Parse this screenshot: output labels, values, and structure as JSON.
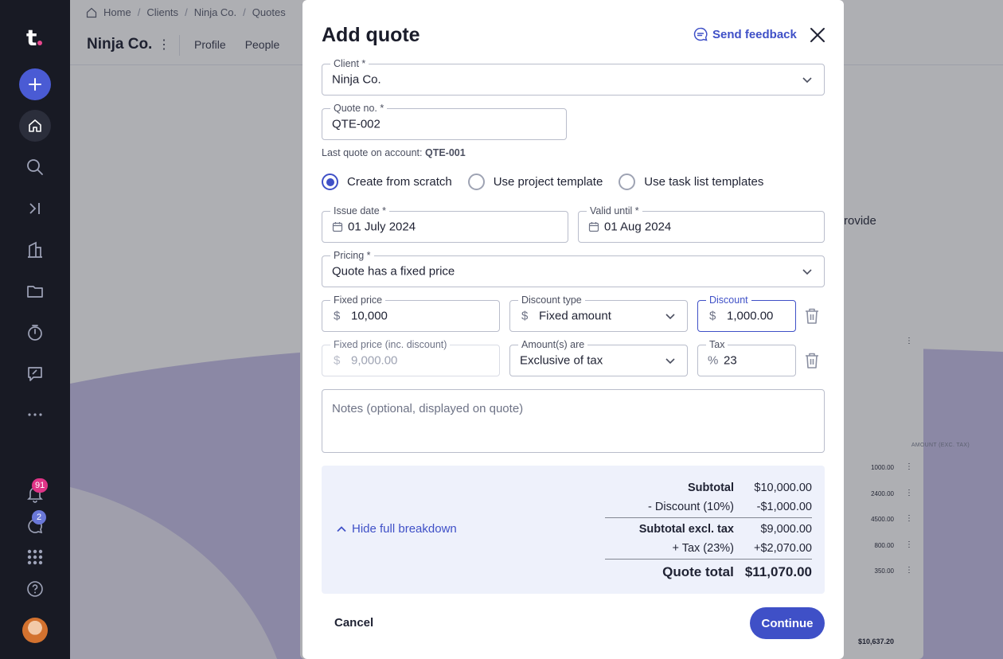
{
  "sidebar": {
    "logo": "t",
    "notifications_count": "91",
    "messages_count": "2"
  },
  "background": {
    "breadcrumb": [
      "Home",
      "Clients",
      "Ninja Co.",
      "Quotes"
    ],
    "title": "Ninja Co.",
    "tabs": [
      "Profile",
      "People"
    ],
    "partial_text": "rovide",
    "table_header": "AMOUNT (EXC. TAX)",
    "table_values": [
      "1000.00",
      "2400.00",
      "4500.00",
      "800.00",
      "350.00"
    ],
    "table_total": "$10,637.20"
  },
  "modal": {
    "title": "Add quote",
    "feedback_label": "Send feedback",
    "client": {
      "label": "Client *",
      "value": "Ninja Co."
    },
    "quote_no": {
      "label": "Quote no. *",
      "value": "QTE-002"
    },
    "last_quote_hint": "Last quote on account: ",
    "last_quote_value": "QTE-001",
    "radio_options": [
      "Create from scratch",
      "Use project template",
      "Use task list templates"
    ],
    "selected_radio": "Create from scratch",
    "issue_date": {
      "label": "Issue date *",
      "value": "01 July 2024"
    },
    "valid_until": {
      "label": "Valid until *",
      "value": "01 Aug 2024"
    },
    "pricing": {
      "label": "Pricing *",
      "value": "Quote has a fixed price"
    },
    "fixed_price": {
      "label": "Fixed price",
      "prefix": "$",
      "value": "10,000"
    },
    "discount_type": {
      "label": "Discount type",
      "prefix": "$",
      "value": "Fixed amount"
    },
    "discount": {
      "label": "Discount",
      "prefix": "$",
      "value": "1,000.00"
    },
    "fixed_price_inc": {
      "label": "Fixed price (inc. discount)",
      "prefix": "$",
      "value": "9,000.00"
    },
    "amounts_are": {
      "label": "Amount(s) are",
      "value": "Exclusive of tax"
    },
    "tax": {
      "label": "Tax",
      "prefix": "%",
      "value": "23"
    },
    "notes_placeholder": "Notes (optional, displayed on quote)",
    "breakdown_label": "Hide full breakdown",
    "summary": {
      "subtotal_label": "Subtotal",
      "subtotal_value": "$10,000.00",
      "discount_label": "- Discount (10%)",
      "discount_value": "-$1,000.00",
      "subtotal_excl_label": "Subtotal excl. tax",
      "subtotal_excl_value": "$9,000.00",
      "tax_label": "+ Tax (23%)",
      "tax_value": "+$2,070.00",
      "total_label": "Quote total",
      "total_value": "$11,070.00"
    },
    "cancel_label": "Cancel",
    "continue_label": "Continue"
  },
  "colors": {
    "accent": "#3f50c7",
    "sidebar_bg": "#181a24",
    "summary_bg": "#eef1fb",
    "badge_pink": "#e03487"
  }
}
